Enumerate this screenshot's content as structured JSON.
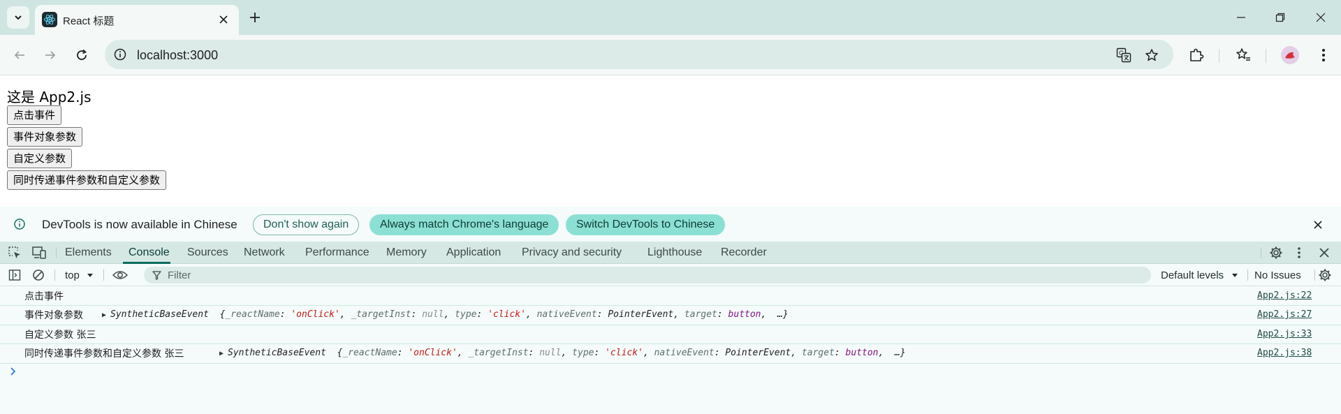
{
  "browser": {
    "tab_title": "React 标题",
    "url": "localhost:3000"
  },
  "page": {
    "heading": "这是 App2.js",
    "buttons": [
      "点击事件",
      "事件对象参数",
      "自定义参数",
      "同时传递事件参数和自定义参数"
    ]
  },
  "devtools": {
    "infobar": {
      "message": "DevTools is now available in Chinese",
      "dont_show": "Don't show again",
      "always_match": "Always match Chrome's language",
      "switch": "Switch DevTools to Chinese"
    },
    "tabs": [
      "Elements",
      "Console",
      "Sources",
      "Network",
      "Performance",
      "Memory",
      "Application",
      "Privacy and security",
      "Lighthouse",
      "Recorder"
    ],
    "active_tab": "Console",
    "console_toolbar": {
      "context": "top",
      "filter_placeholder": "Filter",
      "levels": "Default levels",
      "issues": "No Issues"
    },
    "logs": [
      {
        "text": "点击事件",
        "source": "App2.js:22"
      },
      {
        "text": "事件对象参数",
        "source": "App2.js:27",
        "object": true
      },
      {
        "text": "自定义参数 张三",
        "source": "App2.js:33"
      },
      {
        "text": "同时传递事件参数和自定义参数 张三",
        "source": "App2.js:38",
        "object": true
      }
    ],
    "object_preview": {
      "class_name": "SyntheticBaseEvent",
      "reactName_key": "_reactName",
      "reactName_val": "'onClick'",
      "targetInst_key": "_targetInst",
      "targetInst_val": "null",
      "type_key": "type",
      "type_val": "'click'",
      "nativeEvent_key": "nativeEvent",
      "nativeEvent_val": "PointerEvent",
      "target_key": "target",
      "target_val": "button",
      "ellipsis": "…"
    }
  },
  "colors": {
    "tabstrip": "#cfe5e1",
    "accent": "#8be0d3",
    "string": "#c41a16",
    "dom_node": "#881280"
  }
}
